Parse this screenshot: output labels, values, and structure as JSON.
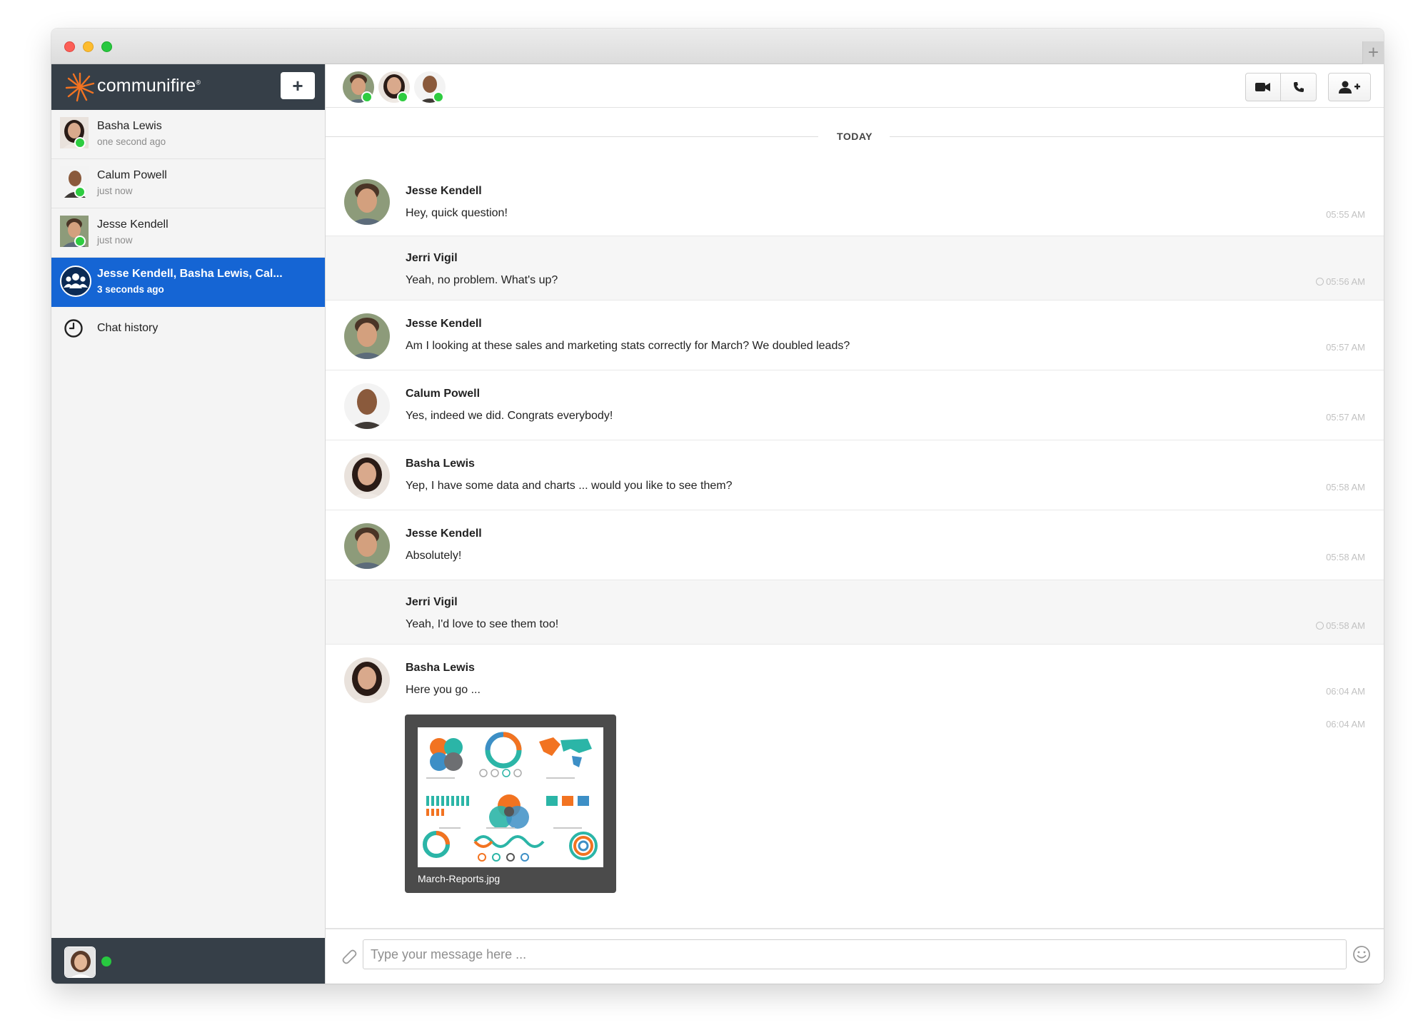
{
  "app": {
    "brand": "communifire",
    "brand_mark": "®"
  },
  "sidebar": {
    "new_chat_label": "+",
    "contacts": [
      {
        "name": "Basha Lewis",
        "time": "one second ago",
        "online": true
      },
      {
        "name": "Calum Powell",
        "time": "just now",
        "online": true
      },
      {
        "name": "Jesse Kendell",
        "time": "just now",
        "online": true
      },
      {
        "name": "Jesse Kendell, Basha Lewis, Cal...",
        "time": "3 seconds ago",
        "active": true
      }
    ],
    "history_label": "Chat history"
  },
  "header": {
    "participants": [
      "Jesse Kendell",
      "Basha Lewis",
      "Calum Powell"
    ],
    "buttons": [
      "video-call",
      "voice-call",
      "add-user"
    ]
  },
  "chat": {
    "divider": "TODAY",
    "messages": [
      {
        "author": "Jesse Kendell",
        "text": "Hey, quick question!",
        "time": "05:55 AM"
      },
      {
        "author": "Jerri Vigil",
        "text": "Yeah, no problem. What's up?",
        "time": "05:56 AM",
        "self": true
      },
      {
        "author": "Jesse Kendell",
        "text": "Am I looking at these sales and marketing stats correctly for March? We doubled leads?",
        "time": "05:57 AM"
      },
      {
        "author": "Calum Powell",
        "text": "Yes, indeed we did. Congrats everybody!",
        "time": "05:57 AM"
      },
      {
        "author": "Basha Lewis",
        "text": "Yep, I have some data and charts ... would you like to see them?",
        "time": "05:58 AM"
      },
      {
        "author": "Jesse Kendell",
        "text": "Absolutely!",
        "time": "05:58 AM"
      },
      {
        "author": "Jerri Vigil",
        "text": "Yeah, I'd love to see them too!",
        "time": "05:58 AM",
        "self": true
      },
      {
        "author": "Basha Lewis",
        "text": "Here you go ...",
        "time": "06:04 AM",
        "attachment_time": "06:04 AM",
        "attachment": "March-Reports.jpg"
      }
    ]
  },
  "compose": {
    "placeholder": "Type your message here ..."
  },
  "colors": {
    "accent": "#1565d4",
    "header": "#363f48",
    "online": "#2ecc40",
    "brand_orange": "#f27321"
  }
}
